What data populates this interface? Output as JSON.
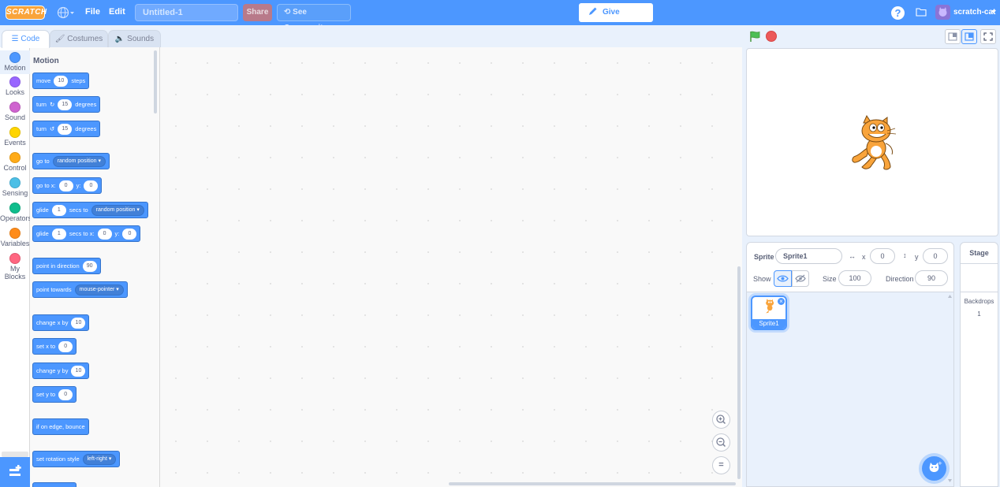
{
  "menubar": {
    "logo": "SCRATCH",
    "file": "File",
    "edit": "Edit",
    "project_title": "Untitled-1",
    "share": "Share",
    "see_community": "See Community",
    "give_feedback": "Give Feedback",
    "username": "scratch-cat"
  },
  "tabs": {
    "code": "Code",
    "costumes": "Costumes",
    "sounds": "Sounds"
  },
  "categories": [
    {
      "label": "Motion",
      "color": "#4c97ff"
    },
    {
      "label": "Looks",
      "color": "#9966ff"
    },
    {
      "label": "Sound",
      "color": "#cf63cf"
    },
    {
      "label": "Events",
      "color": "#ffd500"
    },
    {
      "label": "Control",
      "color": "#ffab19"
    },
    {
      "label": "Sensing",
      "color": "#4cbfe6"
    },
    {
      "label": "Operators",
      "color": "#0fbd8c"
    },
    {
      "label": "Variables",
      "color": "#ff8c1a"
    },
    {
      "label": "My",
      "label2": "Blocks",
      "color": "#ff6680"
    }
  ],
  "palette": {
    "title": "Motion",
    "blocks": {
      "move": {
        "a": "move",
        "v": "10",
        "b": "steps"
      },
      "turn_cw": {
        "a": "turn",
        "v": "15",
        "b": "degrees"
      },
      "turn_ccw": {
        "a": "turn",
        "v": "15",
        "b": "degrees"
      },
      "goto": {
        "a": "go to",
        "dd": "random position"
      },
      "gotoxy": {
        "a": "go to x:",
        "x": "0",
        "b": "y:",
        "y": "0"
      },
      "glide_to": {
        "a": "glide",
        "v": "1",
        "b": "secs to",
        "dd": "random position"
      },
      "glide_xy": {
        "a": "glide",
        "v": "1",
        "b": "secs to x:",
        "x": "0",
        "c": "y:",
        "y": "0"
      },
      "point_dir": {
        "a": "point in direction",
        "v": "90"
      },
      "point_towards": {
        "a": "point towards",
        "dd": "mouse-pointer"
      },
      "change_x": {
        "a": "change x by",
        "v": "10"
      },
      "set_x": {
        "a": "set x to",
        "v": "0"
      },
      "change_y": {
        "a": "change y by",
        "v": "10"
      },
      "set_y": {
        "a": "set y to",
        "v": "0"
      },
      "bounce": {
        "a": "if on edge, bounce"
      },
      "rotation": {
        "a": "set rotation style",
        "dd": "left-right"
      }
    }
  },
  "zoom": {
    "in": "+",
    "out": "−",
    "reset": "="
  },
  "sprite_info": {
    "sprite_label": "Sprite",
    "sprite_name": "Sprite1",
    "x_label": "x",
    "x_value": "0",
    "y_label": "y",
    "y_value": "0",
    "show_label": "Show",
    "size_label": "Size",
    "size_value": "100",
    "direction_label": "Direction",
    "direction_value": "90"
  },
  "sprites": [
    {
      "name": "Sprite1"
    }
  ],
  "stage_panel": {
    "title": "Stage",
    "backdrops_label": "Backdrops",
    "backdrops_count": "1"
  },
  "colors": {
    "menubar": "#4c97ff",
    "motion": "#4c97ff",
    "stop": "#ec5959",
    "flag": "#4cbf56"
  }
}
